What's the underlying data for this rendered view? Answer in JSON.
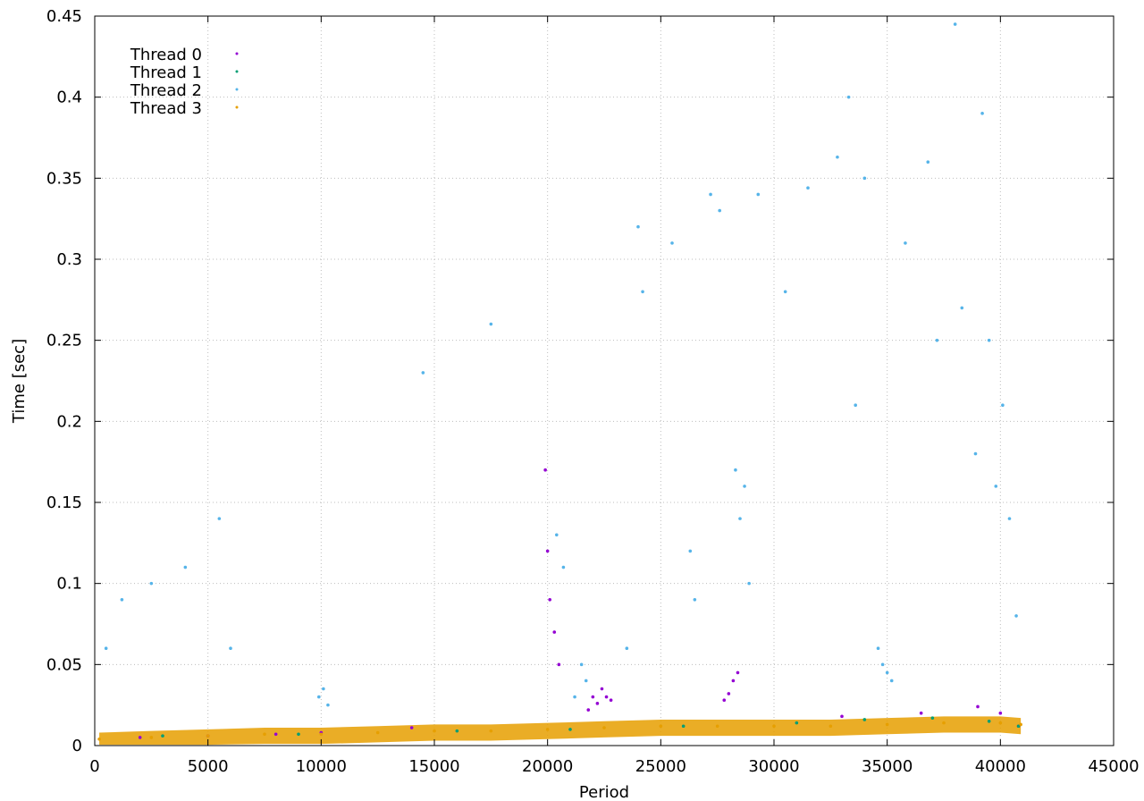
{
  "chart_data": {
    "type": "scatter",
    "xlabel": "Period",
    "ylabel": "Time [sec]",
    "xlim": [
      0,
      45000
    ],
    "ylim": [
      0,
      0.45
    ],
    "x_ticks": [
      0,
      5000,
      10000,
      15000,
      20000,
      25000,
      30000,
      35000,
      40000,
      45000
    ],
    "x_tick_labels": [
      "0",
      "5000",
      "10000",
      "15000",
      "20000",
      "25000",
      "30000",
      "35000",
      "40000",
      "45000"
    ],
    "y_ticks": [
      0,
      0.05,
      0.1,
      0.15,
      0.2,
      0.25,
      0.3,
      0.35,
      0.4,
      0.45
    ],
    "y_tick_labels": [
      "0",
      "0.05",
      "0.1",
      "0.15",
      "0.2",
      "0.25",
      "0.3",
      "0.35",
      "0.4",
      "0.45"
    ],
    "grid": true,
    "legend_position": "top-left",
    "series": [
      {
        "name": "Thread 0",
        "color": "#9400d3",
        "points": [
          [
            2000,
            0.005
          ],
          [
            5000,
            0.006
          ],
          [
            8000,
            0.007
          ],
          [
            10000,
            0.008
          ],
          [
            14000,
            0.011
          ],
          [
            19900,
            0.17
          ],
          [
            20000,
            0.12
          ],
          [
            20100,
            0.09
          ],
          [
            20300,
            0.07
          ],
          [
            20500,
            0.05
          ],
          [
            21800,
            0.022
          ],
          [
            22000,
            0.03
          ],
          [
            22200,
            0.026
          ],
          [
            22400,
            0.035
          ],
          [
            22600,
            0.03
          ],
          [
            22800,
            0.028
          ],
          [
            27800,
            0.028
          ],
          [
            28000,
            0.032
          ],
          [
            28200,
            0.04
          ],
          [
            28400,
            0.045
          ],
          [
            33000,
            0.018
          ],
          [
            36500,
            0.02
          ],
          [
            39000,
            0.024
          ],
          [
            40000,
            0.02
          ],
          [
            40800,
            0.012
          ]
        ]
      },
      {
        "name": "Thread 1",
        "color": "#009e73",
        "points": [
          [
            3000,
            0.006
          ],
          [
            9000,
            0.007
          ],
          [
            16000,
            0.009
          ],
          [
            21000,
            0.01
          ],
          [
            26000,
            0.012
          ],
          [
            31000,
            0.014
          ],
          [
            34000,
            0.016
          ],
          [
            37000,
            0.017
          ],
          [
            39500,
            0.015
          ],
          [
            40800,
            0.012
          ]
        ]
      },
      {
        "name": "Thread 2",
        "color": "#56b4e9",
        "points": [
          [
            500,
            0.06
          ],
          [
            1200,
            0.09
          ],
          [
            2500,
            0.1
          ],
          [
            4000,
            0.11
          ],
          [
            5500,
            0.14
          ],
          [
            6000,
            0.06
          ],
          [
            9900,
            0.03
          ],
          [
            10100,
            0.035
          ],
          [
            10300,
            0.025
          ],
          [
            14500,
            0.23
          ],
          [
            17500,
            0.26
          ],
          [
            20400,
            0.13
          ],
          [
            20700,
            0.11
          ],
          [
            21200,
            0.03
          ],
          [
            21500,
            0.05
          ],
          [
            21700,
            0.04
          ],
          [
            23500,
            0.06
          ],
          [
            24000,
            0.32
          ],
          [
            24200,
            0.28
          ],
          [
            25500,
            0.31
          ],
          [
            26300,
            0.12
          ],
          [
            26500,
            0.09
          ],
          [
            27200,
            0.34
          ],
          [
            27600,
            0.33
          ],
          [
            28300,
            0.17
          ],
          [
            28500,
            0.14
          ],
          [
            28700,
            0.16
          ],
          [
            28900,
            0.1
          ],
          [
            29300,
            0.34
          ],
          [
            30500,
            0.28
          ],
          [
            31500,
            0.344
          ],
          [
            32800,
            0.363
          ],
          [
            33300,
            0.4
          ],
          [
            33600,
            0.21
          ],
          [
            34000,
            0.35
          ],
          [
            34600,
            0.06
          ],
          [
            34800,
            0.05
          ],
          [
            35000,
            0.045
          ],
          [
            35200,
            0.04
          ],
          [
            35800,
            0.31
          ],
          [
            36800,
            0.36
          ],
          [
            37200,
            0.25
          ],
          [
            38000,
            0.445
          ],
          [
            38300,
            0.27
          ],
          [
            38900,
            0.18
          ],
          [
            39200,
            0.39
          ],
          [
            39500,
            0.25
          ],
          [
            39800,
            0.16
          ],
          [
            40100,
            0.21
          ],
          [
            40400,
            0.14
          ],
          [
            40700,
            0.08
          ]
        ]
      },
      {
        "name": "Thread 3",
        "color": "#e69f00",
        "points": [
          [
            200,
            0.004
          ],
          [
            2500,
            0.005
          ],
          [
            5000,
            0.006
          ],
          [
            7500,
            0.007
          ],
          [
            10000,
            0.007
          ],
          [
            12500,
            0.008
          ],
          [
            15000,
            0.009
          ],
          [
            17500,
            0.009
          ],
          [
            20000,
            0.01
          ],
          [
            22500,
            0.011
          ],
          [
            25000,
            0.012
          ],
          [
            27500,
            0.012
          ],
          [
            30000,
            0.012
          ],
          [
            32500,
            0.012
          ],
          [
            35000,
            0.013
          ],
          [
            37500,
            0.014
          ],
          [
            40000,
            0.014
          ],
          [
            40900,
            0.013
          ]
        ]
      }
    ]
  }
}
